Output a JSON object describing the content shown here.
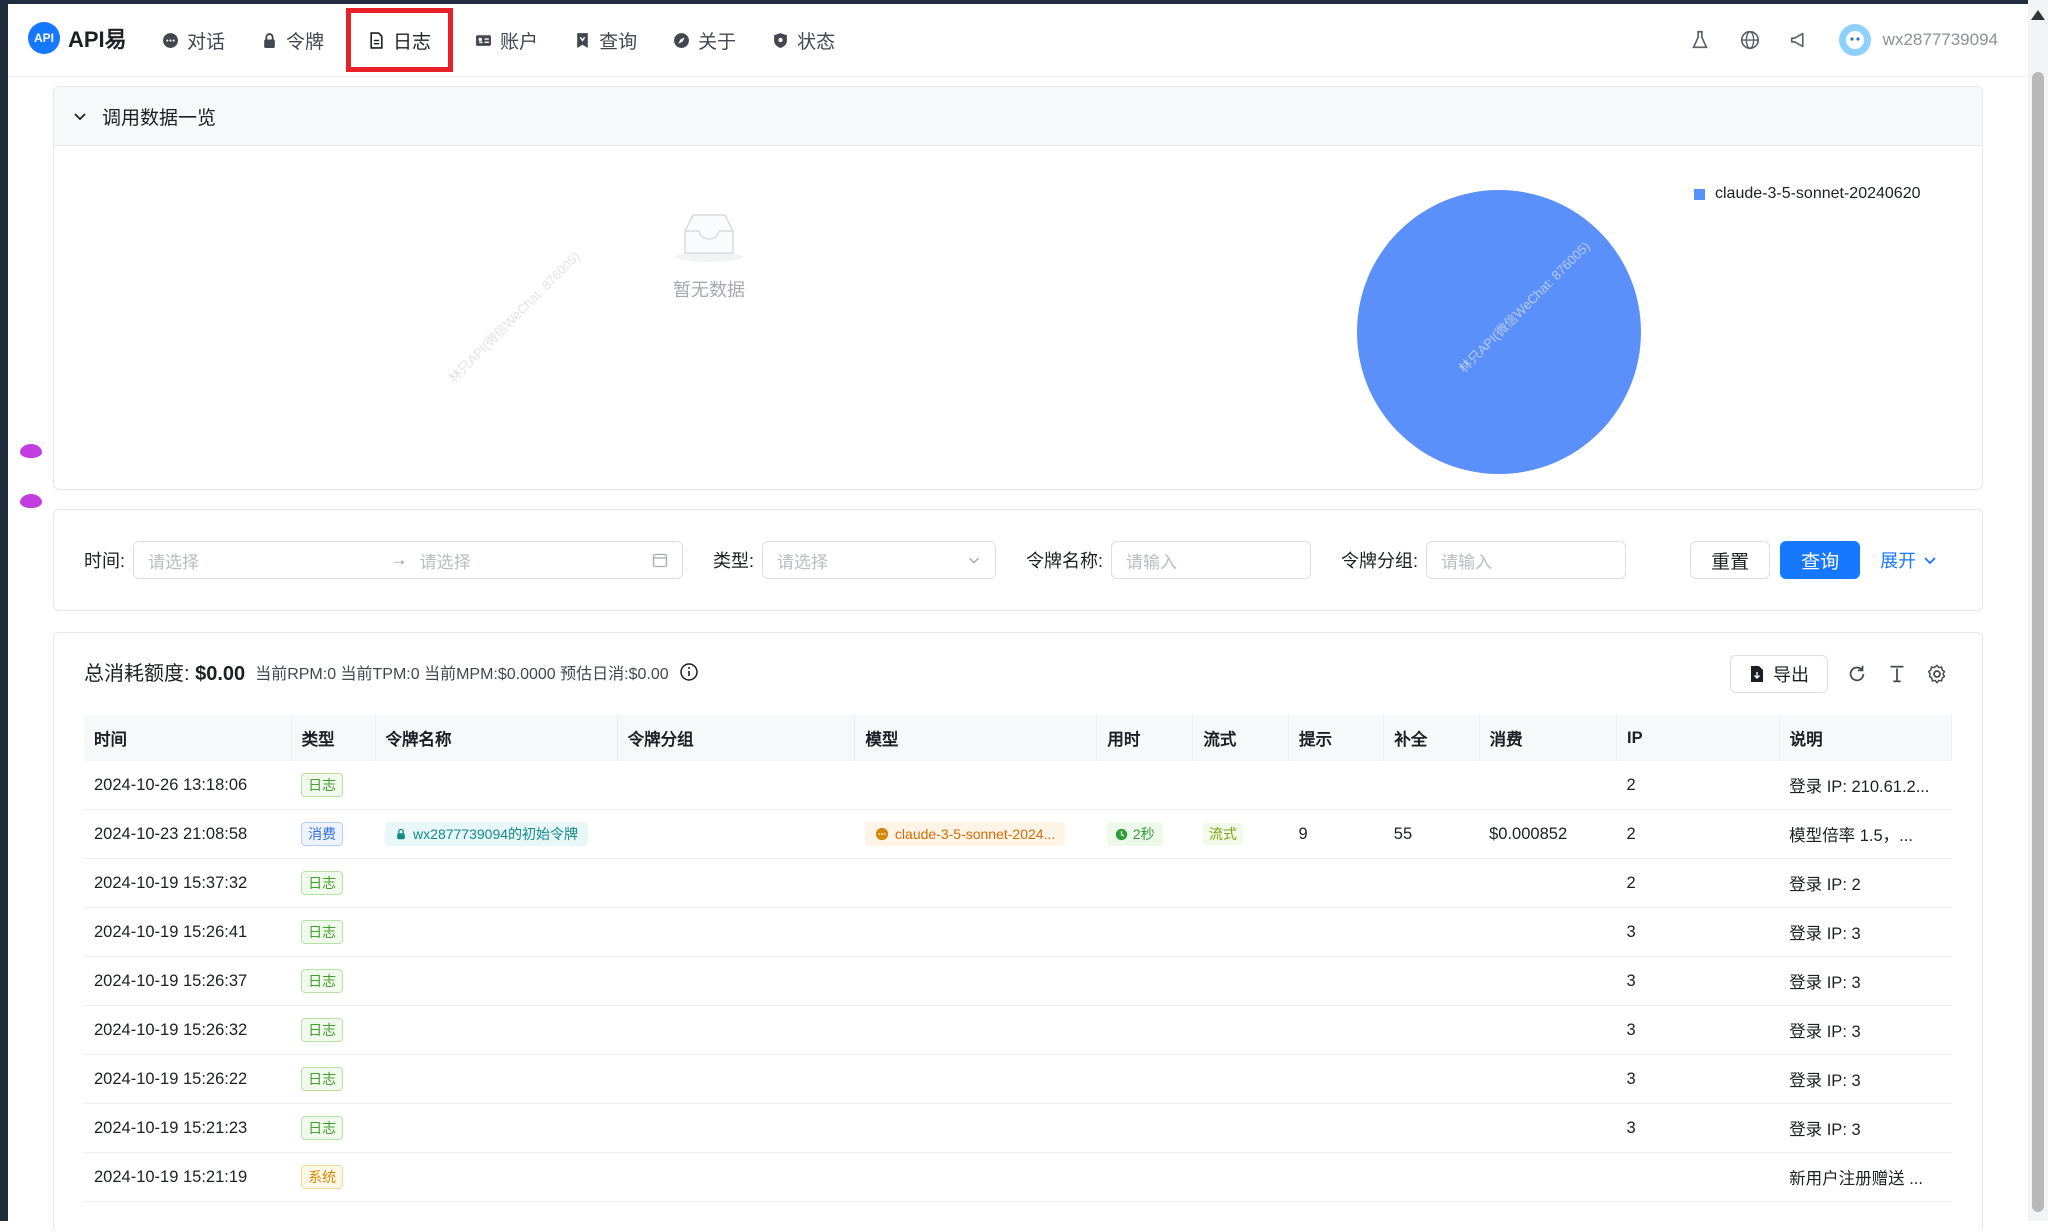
{
  "brand": {
    "logo_text": "API",
    "name": "API易"
  },
  "nav": [
    {
      "label": "对话",
      "icon": "chat-icon"
    },
    {
      "label": "令牌",
      "icon": "lock-icon"
    },
    {
      "label": "日志",
      "icon": "document-icon",
      "active": true
    },
    {
      "label": "账户",
      "icon": "id-card-icon"
    },
    {
      "label": "查询",
      "icon": "query-icon"
    },
    {
      "label": "关于",
      "icon": "compass-icon"
    },
    {
      "label": "状态",
      "icon": "shield-icon"
    }
  ],
  "user": {
    "name": "wx2877739094"
  },
  "overview": {
    "title": "调用数据一览",
    "empty_text": "暂无数据",
    "watermark": "林只API(微信WeChat: 876005)",
    "legend": [
      {
        "name": "claude-3-5-sonnet-20240620",
        "color": "#5b8ff9"
      }
    ]
  },
  "chart_data": {
    "type": "pie",
    "categories": [
      "claude-3-5-sonnet-20240620"
    ],
    "values": [
      100
    ]
  },
  "filters": {
    "time_label": "时间:",
    "start_placeholder": "请选择",
    "end_placeholder": "请选择",
    "type_label": "类型:",
    "type_placeholder": "请选择",
    "token_name_label": "令牌名称:",
    "token_name_placeholder": "请输入",
    "token_group_label": "令牌分组:",
    "token_group_placeholder": "请输入",
    "reset": "重置",
    "query": "查询",
    "expand": "展开"
  },
  "stats": {
    "total_label": "总消耗额度:",
    "total_value": "$0.00",
    "meta": "当前RPM:0 当前TPM:0 当前MPM:$0.0000 预估日消:$0.00",
    "export": "导出"
  },
  "table": {
    "columns": [
      "时间",
      "类型",
      "令牌名称",
      "令牌分组",
      "模型",
      "用时",
      "流式",
      "提示",
      "补全",
      "消费",
      "IP",
      "说明"
    ],
    "rows": [
      {
        "time": "2024-10-26 13:18:06",
        "type": "日志",
        "type_kind": "log",
        "token": "",
        "group": "",
        "model": "",
        "duration": "",
        "stream": "",
        "prompt": "",
        "completion": "",
        "cost": "",
        "ip": "2",
        "desc": "登录 IP: 210.61.2..."
      },
      {
        "time": "2024-10-23 21:08:58",
        "type": "消费",
        "type_kind": "consume",
        "token": "wx2877739094的初始令牌",
        "group": "",
        "model": "claude-3-5-sonnet-2024...",
        "duration": "2秒",
        "stream": "流式",
        "prompt": "9",
        "completion": "55",
        "cost": "$0.000852",
        "ip": "2",
        "desc": "模型倍率 1.5，..."
      },
      {
        "time": "2024-10-19 15:37:32",
        "type": "日志",
        "type_kind": "log",
        "token": "",
        "group": "",
        "model": "",
        "duration": "",
        "stream": "",
        "prompt": "",
        "completion": "",
        "cost": "",
        "ip": "2",
        "desc": "登录 IP: 2"
      },
      {
        "time": "2024-10-19 15:26:41",
        "type": "日志",
        "type_kind": "log",
        "token": "",
        "group": "",
        "model": "",
        "duration": "",
        "stream": "",
        "prompt": "",
        "completion": "",
        "cost": "",
        "ip": "3",
        "desc": "登录 IP: 3"
      },
      {
        "time": "2024-10-19 15:26:37",
        "type": "日志",
        "type_kind": "log",
        "token": "",
        "group": "",
        "model": "",
        "duration": "",
        "stream": "",
        "prompt": "",
        "completion": "",
        "cost": "",
        "ip": "3",
        "desc": "登录 IP: 3"
      },
      {
        "time": "2024-10-19 15:26:32",
        "type": "日志",
        "type_kind": "log",
        "token": "",
        "group": "",
        "model": "",
        "duration": "",
        "stream": "",
        "prompt": "",
        "completion": "",
        "cost": "",
        "ip": "3",
        "desc": "登录 IP: 3"
      },
      {
        "time": "2024-10-19 15:26:22",
        "type": "日志",
        "type_kind": "log",
        "token": "",
        "group": "",
        "model": "",
        "duration": "",
        "stream": "",
        "prompt": "",
        "completion": "",
        "cost": "",
        "ip": "3",
        "desc": "登录 IP: 3"
      },
      {
        "time": "2024-10-19 15:21:23",
        "type": "日志",
        "type_kind": "log",
        "token": "",
        "group": "",
        "model": "",
        "duration": "",
        "stream": "",
        "prompt": "",
        "completion": "",
        "cost": "",
        "ip": "3",
        "desc": "登录 IP: 3"
      },
      {
        "time": "2024-10-19 15:21:19",
        "type": "系统",
        "type_kind": "sys",
        "token": "",
        "group": "",
        "model": "",
        "duration": "",
        "stream": "",
        "prompt": "",
        "completion": "",
        "cost": "",
        "ip": "",
        "desc": "新用户注册赠送 ..."
      }
    ]
  },
  "colors": {
    "primary": "#1677ff",
    "pie": "#5b8ff9",
    "active_outline": "#e8202a"
  }
}
